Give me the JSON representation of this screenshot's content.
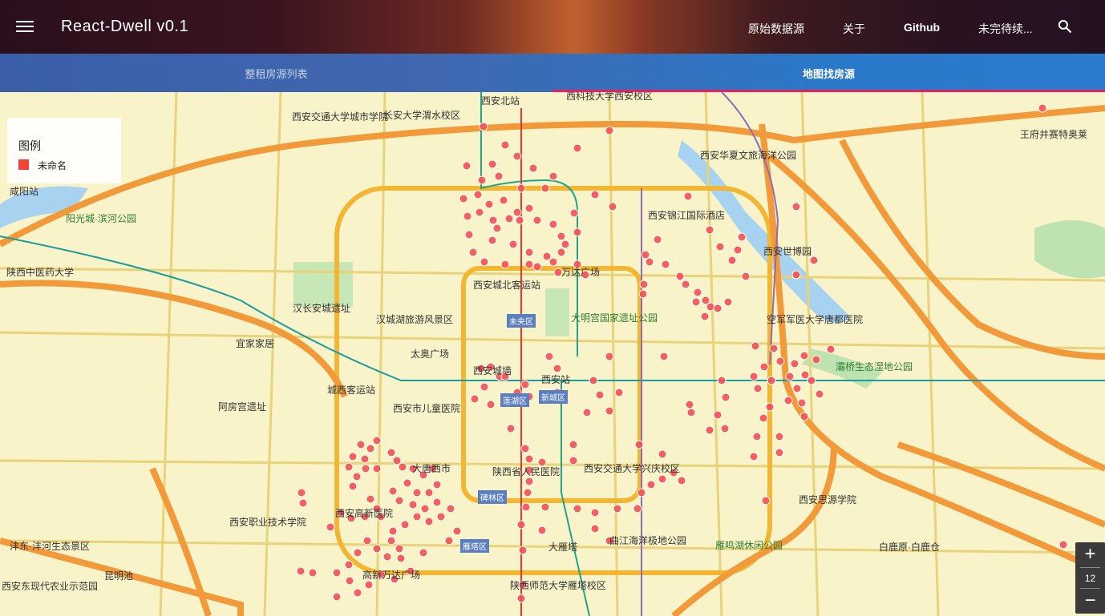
{
  "app": {
    "title": "React-Dwell v0.1",
    "nav": [
      "原始数据源",
      "关于",
      "Github",
      "未完待续..."
    ]
  },
  "tabs": {
    "list": "整租房源列表",
    "map": "地图找房源"
  },
  "legend": {
    "title": "图例",
    "series": "未命名",
    "color": "#f44336"
  },
  "zoom": {
    "in": "+",
    "level": "12",
    "out": "−"
  },
  "map_labels": [
    "西安北站",
    "西科技大学西安校区",
    "西安交通大学城市学院",
    "长安大学渭水校区",
    "西安华夏文旅海洋公园",
    "王府井赛特奥莱",
    "阳光城·滨河公园",
    "咸阳站",
    "陕西中医药大学",
    "西安锦江国际酒店",
    "西安世博园",
    "汉长安城遗址",
    "西安城北客运站",
    "万达广场",
    "大明宫国家遗址公园",
    "汉城湖旅游风景区",
    "宜家家居",
    "太奥广场",
    "空军军医大学唐都医院",
    "灞桥生态湿地公园",
    "城西客运站",
    "西安城墙",
    "西安站",
    "西安市儿童医院",
    "阿房宫遗址",
    "大唐西市",
    "陕西省人民医院",
    "西安交通大学兴庆校区",
    "西安职业技术学院",
    "西安高新医院",
    "西安思源学院",
    "曲江海洋极地公园",
    "大雁塔",
    "雁鸣湖休闲公园",
    "白鹿原·白鹿仓",
    "昆明池",
    "沣东·沣河生态景区",
    "高新万达广场",
    "陕西师范大学雁塔校区",
    "西安东现代农业示范园",
    "未央区",
    "碑林区",
    "雁塔区",
    "新城区",
    "莲湖区"
  ]
}
